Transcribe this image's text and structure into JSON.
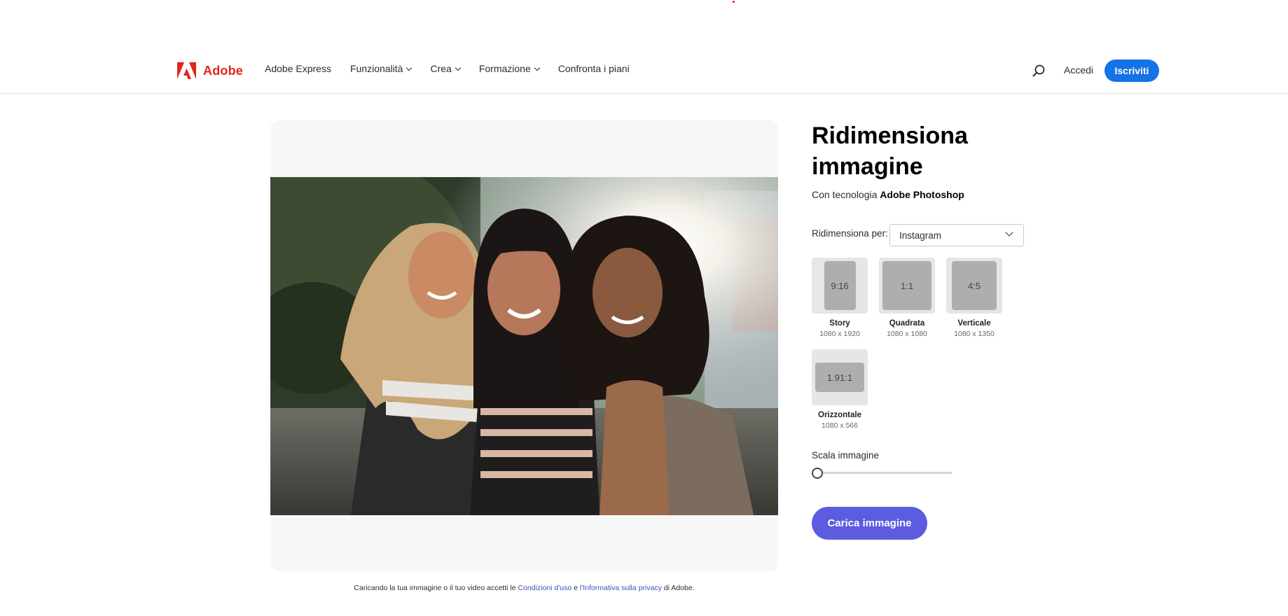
{
  "header": {
    "logo_text": "Adobe",
    "nav": [
      {
        "label": "Adobe Express"
      },
      {
        "label": "Funzionalità"
      },
      {
        "label": "Crea"
      },
      {
        "label": "Formazione"
      },
      {
        "label": "Confronta i piani"
      }
    ],
    "signin_label": "Accedi",
    "signup_label": "Iscriviti",
    "search_icon": "search-icon"
  },
  "tool": {
    "title": "Ridimensiona immagine",
    "powered_prefix": "Con tecnologia",
    "powered_brand": "Adobe Photoshop",
    "resize_label": "Ridimensiona per:",
    "resize_selected": "Instagram",
    "presets": [
      {
        "ratio": "9:16",
        "name": "Story",
        "dims": "1080 x 1920"
      },
      {
        "ratio": "1:1",
        "name": "Quadrata",
        "dims": "1080 x 1080"
      },
      {
        "ratio": "4:5",
        "name": "Verticale",
        "dims": "1080 x 1350"
      },
      {
        "ratio": "1.91:1",
        "name": "Orizzontale",
        "dims": "1080 x 566"
      }
    ],
    "scale_label": "Scala immagine",
    "scale_value": 0,
    "upload_label": "Carica immagine"
  },
  "disclaimer": {
    "prefix": "Caricando la tua immagine o il tuo video accetti le",
    "terms_link": "Condizioni d'uso",
    "middle": "e",
    "privacy_link": "l'Informativa sulla privacy",
    "suffix": "di Adobe."
  },
  "colors": {
    "brand_red": "#e1251b",
    "signup_blue": "#1473e6",
    "upload_purple": "#5c5ce0"
  }
}
